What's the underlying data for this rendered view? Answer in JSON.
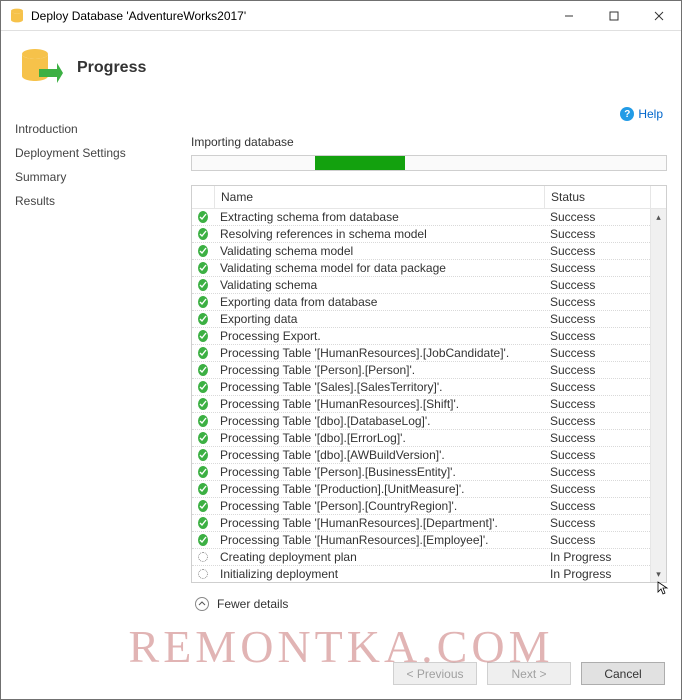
{
  "window": {
    "title": "Deploy Database 'AdventureWorks2017'"
  },
  "header": {
    "heading": "Progress"
  },
  "help": {
    "label": "Help"
  },
  "sidebar": {
    "items": [
      {
        "label": "Introduction"
      },
      {
        "label": "Deployment Settings"
      },
      {
        "label": "Summary"
      },
      {
        "label": "Results"
      }
    ]
  },
  "main": {
    "status_text": "Importing database",
    "progress": {
      "left_pct": 26,
      "width_pct": 19
    },
    "columns": {
      "name": "Name",
      "status": "Status"
    },
    "rows": [
      {
        "icon": "success",
        "name": "Extracting schema from database",
        "status": "Success"
      },
      {
        "icon": "success",
        "name": "Resolving references in schema model",
        "status": "Success"
      },
      {
        "icon": "success",
        "name": "Validating schema model",
        "status": "Success"
      },
      {
        "icon": "success",
        "name": "Validating schema model for data package",
        "status": "Success"
      },
      {
        "icon": "success",
        "name": "Validating schema",
        "status": "Success"
      },
      {
        "icon": "success",
        "name": "Exporting data from database",
        "status": "Success"
      },
      {
        "icon": "success",
        "name": "Exporting data",
        "status": "Success"
      },
      {
        "icon": "success",
        "name": "Processing Export.",
        "status": "Success"
      },
      {
        "icon": "success",
        "name": "Processing Table '[HumanResources].[JobCandidate]'.",
        "status": "Success"
      },
      {
        "icon": "success",
        "name": "Processing Table '[Person].[Person]'.",
        "status": "Success"
      },
      {
        "icon": "success",
        "name": "Processing Table '[Sales].[SalesTerritory]'.",
        "status": "Success"
      },
      {
        "icon": "success",
        "name": "Processing Table '[HumanResources].[Shift]'.",
        "status": "Success"
      },
      {
        "icon": "success",
        "name": "Processing Table '[dbo].[DatabaseLog]'.",
        "status": "Success"
      },
      {
        "icon": "success",
        "name": "Processing Table '[dbo].[ErrorLog]'.",
        "status": "Success"
      },
      {
        "icon": "success",
        "name": "Processing Table '[dbo].[AWBuildVersion]'.",
        "status": "Success"
      },
      {
        "icon": "success",
        "name": "Processing Table '[Person].[BusinessEntity]'.",
        "status": "Success"
      },
      {
        "icon": "success",
        "name": "Processing Table '[Production].[UnitMeasure]'.",
        "status": "Success"
      },
      {
        "icon": "success",
        "name": "Processing Table '[Person].[CountryRegion]'.",
        "status": "Success"
      },
      {
        "icon": "success",
        "name": "Processing Table '[HumanResources].[Department]'.",
        "status": "Success"
      },
      {
        "icon": "success",
        "name": "Processing Table '[HumanResources].[Employee]'.",
        "status": "Success"
      },
      {
        "icon": "progress",
        "name": "Creating deployment plan",
        "status": "In Progress"
      },
      {
        "icon": "progress",
        "name": "Initializing deployment",
        "status": "In Progress"
      }
    ],
    "details_toggle": "Fewer details"
  },
  "buttons": {
    "previous": "< Previous",
    "next": "Next >",
    "cancel": "Cancel"
  },
  "watermark": "REMONTKA.COM"
}
